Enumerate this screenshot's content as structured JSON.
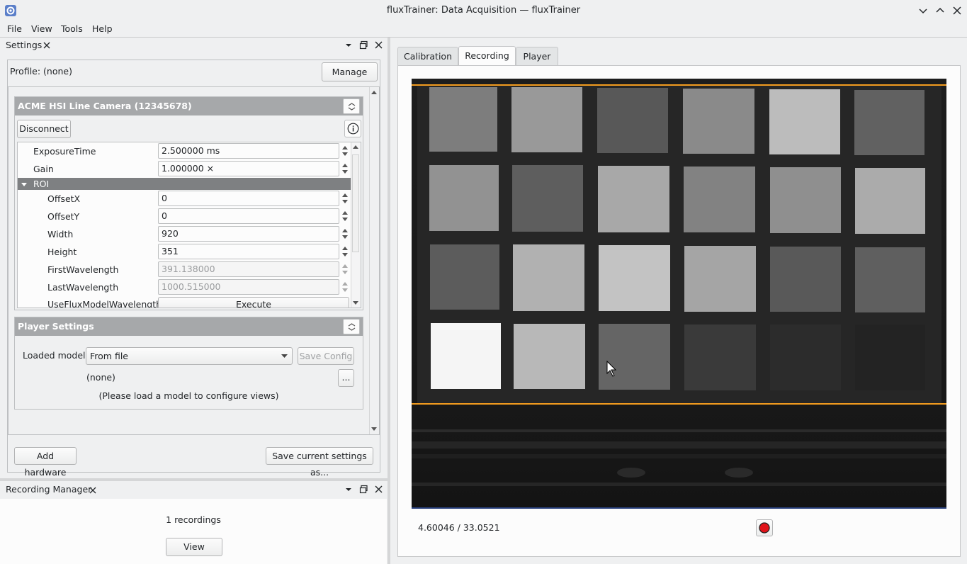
{
  "window": {
    "title": "fluxTrainer: Data Acquisition — fluxTrainer"
  },
  "menu": [
    "File",
    "View",
    "Tools",
    "Help"
  ],
  "settings_dock": {
    "title": "Settings",
    "profile_label": "Profile:  (none)",
    "manage_label": "Manage",
    "camera": {
      "title": "ACME HSI Line Camera (12345678)",
      "disconnect_label": "Disconnect",
      "properties": [
        {
          "name": "ExposureTime",
          "value": "2.500000 ms"
        },
        {
          "name": "Gain",
          "value": "1.000000 ×"
        }
      ],
      "roi_label": "ROI",
      "roi_properties": [
        {
          "name": "OffsetX",
          "value": "0"
        },
        {
          "name": "OffsetY",
          "value": "0"
        },
        {
          "name": "Width",
          "value": "920"
        },
        {
          "name": "Height",
          "value": "351"
        },
        {
          "name": "FirstWavelength",
          "value": "391.138000"
        },
        {
          "name": "LastWavelength",
          "value": "1000.515000"
        }
      ],
      "use_flux_label": "UseFluxModelWavelengths",
      "execute_label": "Execute"
    },
    "player_settings": {
      "title": "Player Settings",
      "loaded_model_label": "Loaded model:",
      "loaded_model_value": "From file",
      "save_config_label": "Save Config",
      "model_name": "(none)",
      "browse_label": "...",
      "hint": "(Please load a model to configure views)"
    },
    "add_hardware_label": "Add hardware",
    "save_settings_label": "Save current settings as..."
  },
  "recording_manager": {
    "title": "Recording Manager",
    "count_text": "1 recordings",
    "view_label": "View"
  },
  "main": {
    "tabs": [
      "Calibration",
      "Recording",
      "Player"
    ],
    "active_tab": "Recording",
    "readout": "4.60046 / 33.0521"
  },
  "colors": {
    "accent": "#f39c1f",
    "record": "#e0141b",
    "header": "#a6a8aa"
  },
  "icons": [
    "app-gear-icon",
    "minimize-icon",
    "maximize-icon",
    "close-icon",
    "float-icon",
    "collapse-icon",
    "info-icon",
    "dropdown-arrow-icon",
    "record-icon"
  ]
}
